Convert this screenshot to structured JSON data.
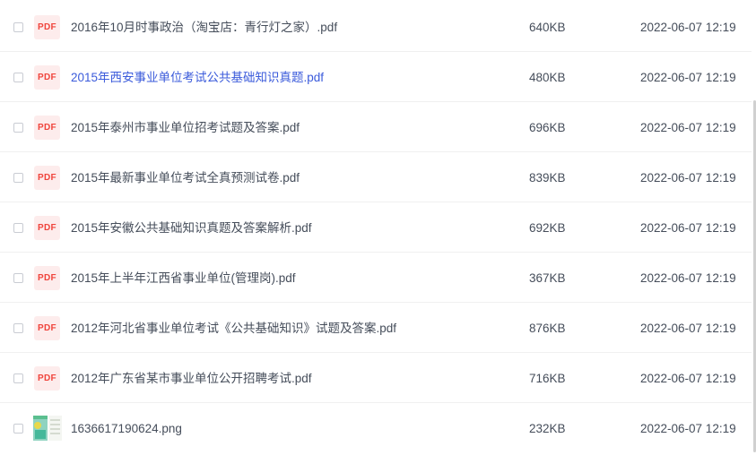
{
  "files": [
    {
      "icon": "PDF",
      "name": "2016年10月时事政治（淘宝店：青行灯之家）.pdf",
      "size": "640KB",
      "date": "2022-06-07 12:19"
    },
    {
      "icon": "PDF",
      "name": "2015年西安事业单位考试公共基础知识真题.pdf",
      "size": "480KB",
      "date": "2022-06-07 12:19"
    },
    {
      "icon": "PDF",
      "name": "2015年泰州市事业单位招考试题及答案.pdf",
      "size": "696KB",
      "date": "2022-06-07 12:19"
    },
    {
      "icon": "PDF",
      "name": "2015年最新事业单位考试全真预测试卷.pdf",
      "size": "839KB",
      "date": "2022-06-07 12:19"
    },
    {
      "icon": "PDF",
      "name": "2015年安徽公共基础知识真题及答案解析.pdf",
      "size": "692KB",
      "date": "2022-06-07 12:19"
    },
    {
      "icon": "PDF",
      "name": "2015年上半年江西省事业单位(管理岗).pdf",
      "size": "367KB",
      "date": "2022-06-07 12:19"
    },
    {
      "icon": "PDF",
      "name": "2012年河北省事业单位考试《公共基础知识》试题及答案.pdf",
      "size": "876KB",
      "date": "2022-06-07 12:19"
    },
    {
      "icon": "PDF",
      "name": "2012年广东省某市事业单位公开招聘考试.pdf",
      "size": "716KB",
      "date": "2022-06-07 12:19"
    },
    {
      "icon": "image-thumbnail-icon",
      "name": "1636617190624.png",
      "size": "232KB",
      "date": "2022-06-07 12:19"
    }
  ],
  "colors": {
    "text": "#454d5a",
    "link_hover": "#3b5bdb",
    "pdf_red": "#f0443c",
    "pdf_bg": "#fdecec"
  }
}
